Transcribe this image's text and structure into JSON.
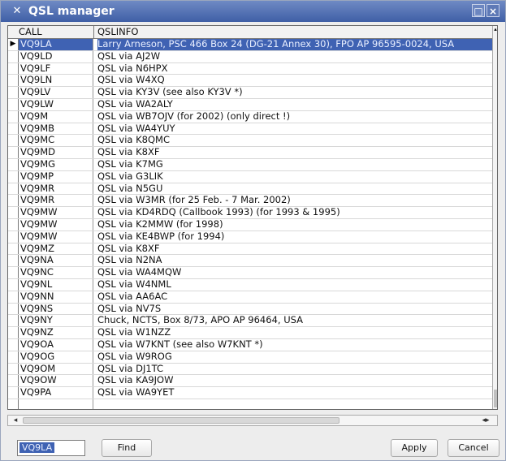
{
  "window": {
    "title": "QSL manager",
    "icon": "app-icon",
    "max_label": "□",
    "close_label": "×"
  },
  "table": {
    "columns": [
      "CALL",
      "QSLINFO"
    ],
    "selected_indicator": "▶",
    "rows": [
      {
        "call": "VQ9LA",
        "info": "Larry Arneson, PSC 466 Box 24 (DG-21 Annex 30), FPO AP 96595-0024, USA",
        "selected": true
      },
      {
        "call": "VQ9LD",
        "info": "QSL via AJ2W"
      },
      {
        "call": "VQ9LF",
        "info": "QSL via N6HPX"
      },
      {
        "call": "VQ9LN",
        "info": "QSL via W4XQ"
      },
      {
        "call": "VQ9LV",
        "info": "QSL via KY3V (see also KY3V *)"
      },
      {
        "call": "VQ9LW",
        "info": "QSL via WA2ALY"
      },
      {
        "call": "VQ9M",
        "info": "QSL via WB7OJV (for 2002) (only direct !)"
      },
      {
        "call": "VQ9MB",
        "info": "QSL via WA4YUY"
      },
      {
        "call": "VQ9MC",
        "info": "QSL via K8QMC"
      },
      {
        "call": "VQ9MD",
        "info": "QSL via K8XF"
      },
      {
        "call": "VQ9MG",
        "info": "QSL via K7MG"
      },
      {
        "call": "VQ9MP",
        "info": "QSL via G3LIK"
      },
      {
        "call": "VQ9MR",
        "info": "QSL via N5GU"
      },
      {
        "call": "VQ9MR",
        "info": "QSL via W3MR (for 25 Feb. - 7 Mar. 2002)"
      },
      {
        "call": "VQ9MW",
        "info": "QSL via KD4RDQ (Callbook 1993) (for 1993 & 1995)"
      },
      {
        "call": "VQ9MW",
        "info": "QSL via K2MMW (for 1998)"
      },
      {
        "call": "VQ9MW",
        "info": "QSL via KE4BWP (for 1994)"
      },
      {
        "call": "VQ9MZ",
        "info": "QSL via K8XF"
      },
      {
        "call": "VQ9NA",
        "info": "QSL via N2NA"
      },
      {
        "call": "VQ9NC",
        "info": "QSL via WA4MQW"
      },
      {
        "call": "VQ9NL",
        "info": "QSL via W4NML"
      },
      {
        "call": "VQ9NN",
        "info": "QSL via AA6AC"
      },
      {
        "call": "VQ9NS",
        "info": "QSL via NV7S"
      },
      {
        "call": "VQ9NY",
        "info": "Chuck, NCTS, Box 8/73, APO AP 96464, USA"
      },
      {
        "call": "VQ9NZ",
        "info": "QSL via W1NZZ"
      },
      {
        "call": "VQ9OA",
        "info": "QSL via W7KNT (see also W7KNT *)"
      },
      {
        "call": "VQ9OG",
        "info": "QSL via W9ROG"
      },
      {
        "call": "VQ9OM",
        "info": "QSL via DJ1TC"
      },
      {
        "call": "VQ9OW",
        "info": "QSL via KA9JOW"
      },
      {
        "call": "VQ9PA",
        "info": "QSL via WA9YET"
      },
      {
        "call": "",
        "info": ""
      },
      {
        "call": "",
        "info": ""
      }
    ]
  },
  "footer": {
    "search_value": "VQ9LA",
    "find_label": "Find",
    "apply_label": "Apply",
    "cancel_label": "Cancel"
  },
  "colors": {
    "title_bar": "#4d6db0",
    "selection": "#3f62b3"
  }
}
